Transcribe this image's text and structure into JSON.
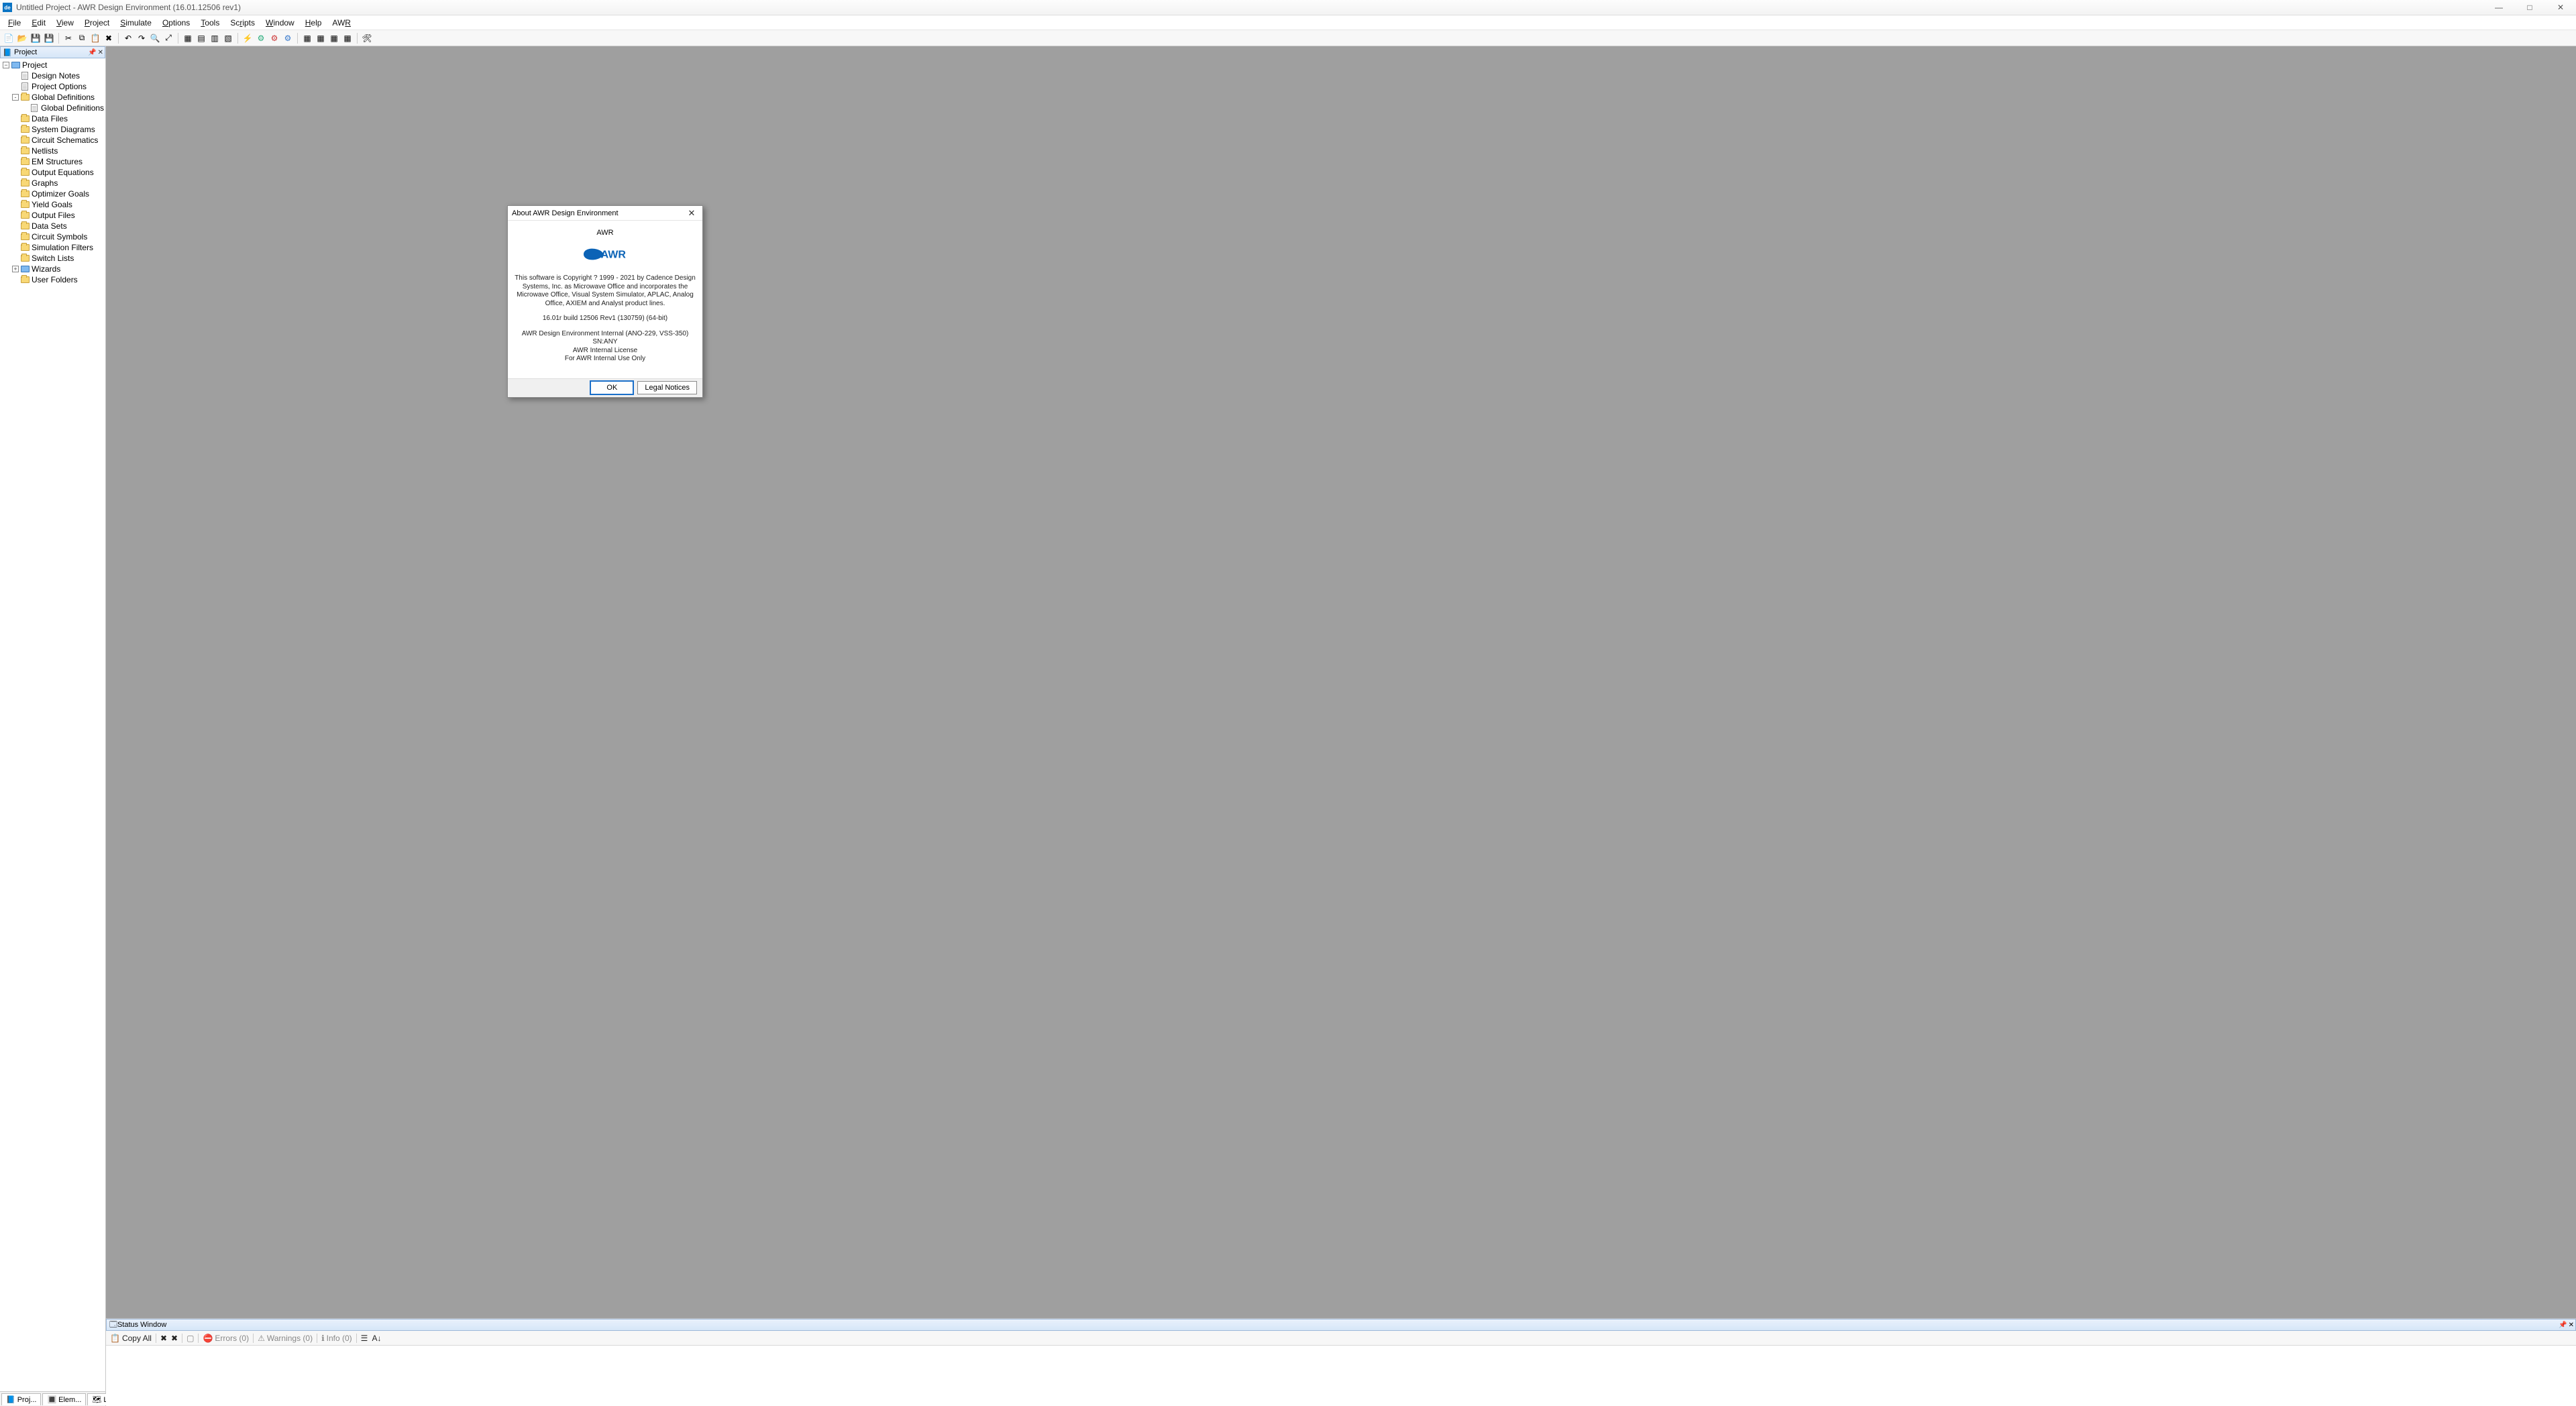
{
  "title": "Untitled Project - AWR Design Environment (16.01.12506 rev1)",
  "menu": [
    "File",
    "Edit",
    "View",
    "Project",
    "Simulate",
    "Options",
    "Tools",
    "Scripts",
    "Window",
    "Help",
    "AWR"
  ],
  "toolbar_icons": [
    "new",
    "open",
    "save",
    "save-all",
    "cut",
    "copy",
    "paste",
    "delete",
    "undo",
    "redo",
    "zoom-sel",
    "zoom-fit",
    "sep",
    "panel1",
    "panel2",
    "panel3",
    "panel4",
    "sep",
    "run",
    "tune",
    "optimize",
    "yield",
    "sep",
    "grid-a",
    "grid-b",
    "grid-c",
    "grid-d",
    "sep",
    "settings"
  ],
  "project_panel": {
    "title": "Project"
  },
  "tree": {
    "root": "Project",
    "items": [
      {
        "label": "Design Notes",
        "icon": "doc",
        "indent": 1
      },
      {
        "label": "Project Options",
        "icon": "doc",
        "indent": 1
      },
      {
        "label": "Global Definitions",
        "icon": "folder",
        "indent": 1,
        "expand": "-"
      },
      {
        "label": "Global Definitions",
        "icon": "doc",
        "indent": 2
      },
      {
        "label": "Data Files",
        "icon": "folder",
        "indent": 1
      },
      {
        "label": "System Diagrams",
        "icon": "folder",
        "indent": 1
      },
      {
        "label": "Circuit Schematics",
        "icon": "folder",
        "indent": 1
      },
      {
        "label": "Netlists",
        "icon": "folder",
        "indent": 1
      },
      {
        "label": "EM Structures",
        "icon": "folder",
        "indent": 1
      },
      {
        "label": "Output Equations",
        "icon": "folder",
        "indent": 1
      },
      {
        "label": "Graphs",
        "icon": "folder",
        "indent": 1
      },
      {
        "label": "Optimizer Goals",
        "icon": "folder",
        "indent": 1
      },
      {
        "label": "Yield Goals",
        "icon": "folder",
        "indent": 1
      },
      {
        "label": "Output Files",
        "icon": "folder",
        "indent": 1
      },
      {
        "label": "Data Sets",
        "icon": "folder",
        "indent": 1
      },
      {
        "label": "Circuit Symbols",
        "icon": "folder",
        "indent": 1
      },
      {
        "label": "Simulation Filters",
        "icon": "folder",
        "indent": 1
      },
      {
        "label": "Switch Lists",
        "icon": "folder",
        "indent": 1
      },
      {
        "label": "Wizards",
        "icon": "bluefolder",
        "indent": 1,
        "expand": "+"
      },
      {
        "label": "User Folders",
        "icon": "folder",
        "indent": 1
      }
    ]
  },
  "bottom_tabs": [
    "Proj...",
    "Elem...",
    "Layo..."
  ],
  "status": {
    "title": "Status Window",
    "copy_all": "Copy All",
    "errors": "Errors (0)",
    "warnings": "Warnings (0)",
    "info": "Info (0)"
  },
  "dialog": {
    "title": "About AWR Design Environment",
    "brand_small": "AWR",
    "logo_text": "AWR",
    "copyright": "This software is Copyright ? 1999 - 2021 by Cadence Design Systems, Inc. as Microwave Office and incorporates the Microwave Office, Visual System Simulator, APLAC, Analog Office, AXIEM and Analyst product lines.",
    "version": "16.01r build 12506 Rev1 (130759) (64-bit)",
    "license1": "AWR Design Environment Internal (ANO-229, VSS-350) SN:ANY",
    "license2": "AWR Internal License",
    "license3": "For AWR Internal Use Only",
    "ok": "OK",
    "legal": "Legal Notices"
  }
}
